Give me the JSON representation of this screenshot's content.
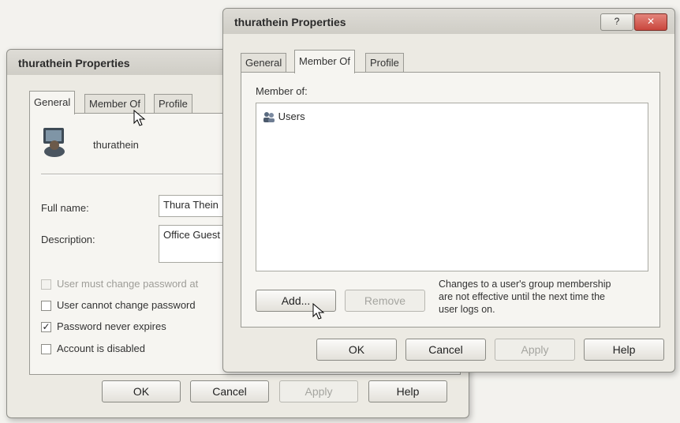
{
  "back_window": {
    "title": "thurathein Properties",
    "tabs": [
      "General",
      "Member Of",
      "Profile"
    ],
    "username": "thurathein",
    "full_name_label": "Full name:",
    "full_name_value": "Thura Thein",
    "description_label": "Description:",
    "description_value": "Office Guest",
    "checkboxes": [
      {
        "label": "User must change password at",
        "checked": false,
        "disabled": true
      },
      {
        "label": "User cannot change password",
        "checked": false,
        "disabled": false
      },
      {
        "label": "Password never expires",
        "checked": true,
        "disabled": false
      },
      {
        "label": "Account is disabled",
        "checked": false,
        "disabled": false
      }
    ],
    "buttons": {
      "ok": "OK",
      "cancel": "Cancel",
      "apply": "Apply",
      "help": "Help"
    },
    "check_mark": "✓"
  },
  "front_window": {
    "title": "thurathein Properties",
    "help_glyph": "?",
    "close_glyph": "✕",
    "tabs": [
      "General",
      "Member Of",
      "Profile"
    ],
    "member_of_label": "Member of:",
    "groups": [
      "Users"
    ],
    "add_label": "Add...",
    "remove_label": "Remove",
    "note": [
      "Changes to a user's group membership",
      "are not effective until the next time the",
      "user logs on."
    ],
    "buttons": {
      "ok": "OK",
      "cancel": "Cancel",
      "apply": "Apply",
      "help": "Help"
    }
  },
  "colors": {
    "close_button": "#c9463d",
    "window_bg": "#eceae3",
    "panel_bg": "#f6f5f1"
  }
}
